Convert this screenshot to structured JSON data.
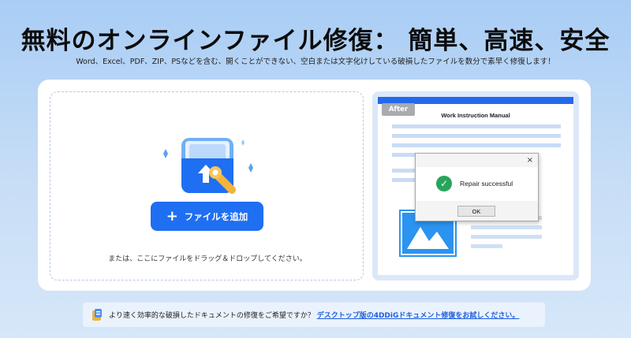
{
  "header": {
    "title": "無料のオンラインファイル修復： 簡単、高速、安全",
    "subtitle": "Word、Excel、PDF、ZIP、PSなどを含む、開くことができない、空白または文字化けしている破損したファイルを数分で素早く修復します！"
  },
  "upload": {
    "add_button_label": "ファイルを追加",
    "plus_icon": "+",
    "drop_hint": "または、ここにファイルをドラッグ＆ドロップしてください。",
    "illustration_icon": "folder-wrench-icon"
  },
  "preview": {
    "badge": "After",
    "doc_title": "Work Instruction Manual",
    "dialog": {
      "close": "×",
      "message": "Repair successful",
      "ok_label": "OK",
      "icon": "check-circle-icon"
    }
  },
  "footer": {
    "prompt": "より速く効率的な破損したドキュメントの修復をご希望ですか？",
    "link": "デスクトップ版の4DDiGドキュメント修復をお試しください。"
  },
  "colors": {
    "accent": "#1f6ff2",
    "success": "#27a55a",
    "link": "#1d5fe0"
  }
}
